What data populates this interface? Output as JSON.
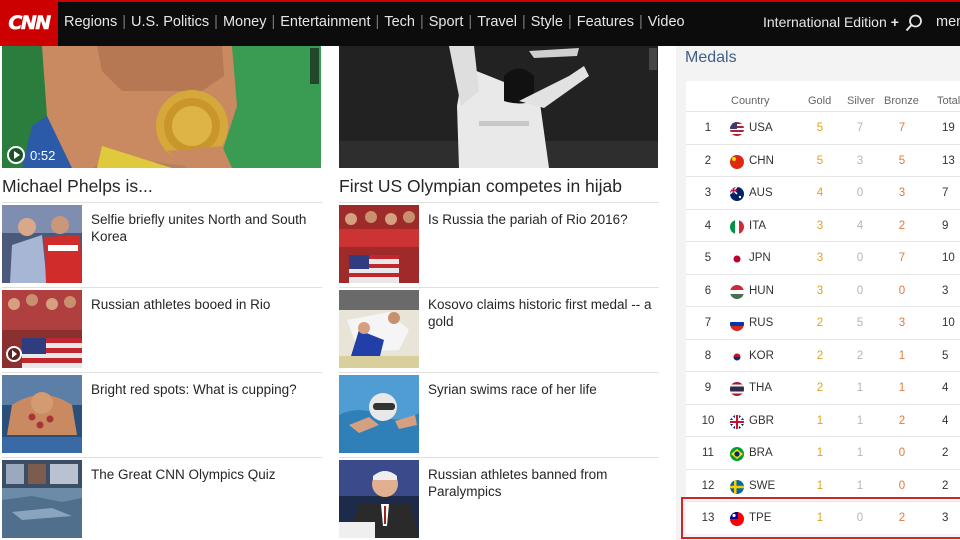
{
  "nav": {
    "logo": "CNN",
    "links": [
      "Regions",
      "U.S. Politics",
      "Money",
      "Entertainment",
      "Tech",
      "Sport",
      "Travel",
      "Style",
      "Features",
      "Video"
    ],
    "edition": "International Edition",
    "edition_plus": "+",
    "menu": "menu"
  },
  "heroes": [
    {
      "headline": "Michael Phelps is...",
      "duration": "0:52"
    },
    {
      "headline": "First US Olympian competes in hijab"
    }
  ],
  "stories_left": [
    {
      "title": "Selfie briefly unites North and South Korea",
      "video": false
    },
    {
      "title": "Russian athletes booed in Rio",
      "video": true
    },
    {
      "title": "Bright red spots: What is cupping?",
      "video": false
    },
    {
      "title": "The Great CNN Olympics Quiz",
      "video": false
    }
  ],
  "stories_right": [
    {
      "title": "Is Russia the pariah of Rio 2016?",
      "video": false
    },
    {
      "title": "Kosovo claims historic first medal -- a gold",
      "video": false
    },
    {
      "title": "Syrian swims race of her life",
      "video": false
    },
    {
      "title": "Russian athletes banned from Paralympics",
      "video": false
    }
  ],
  "medals": {
    "title": "Medals",
    "headers": {
      "country": "Country",
      "gold": "Gold",
      "silver": "Silver",
      "bronze": "Bronze",
      "total": "Total"
    },
    "rows": [
      {
        "rank": "1",
        "code": "USA",
        "gold": "5",
        "silver": "7",
        "bronze": "7",
        "total": "19"
      },
      {
        "rank": "2",
        "code": "CHN",
        "gold": "5",
        "silver": "3",
        "bronze": "5",
        "total": "13"
      },
      {
        "rank": "3",
        "code": "AUS",
        "gold": "4",
        "silver": "0",
        "bronze": "3",
        "total": "7"
      },
      {
        "rank": "4",
        "code": "ITA",
        "gold": "3",
        "silver": "4",
        "bronze": "2",
        "total": "9"
      },
      {
        "rank": "5",
        "code": "JPN",
        "gold": "3",
        "silver": "0",
        "bronze": "7",
        "total": "10"
      },
      {
        "rank": "6",
        "code": "HUN",
        "gold": "3",
        "silver": "0",
        "bronze": "0",
        "total": "3"
      },
      {
        "rank": "7",
        "code": "RUS",
        "gold": "2",
        "silver": "5",
        "bronze": "3",
        "total": "10"
      },
      {
        "rank": "8",
        "code": "KOR",
        "gold": "2",
        "silver": "2",
        "bronze": "1",
        "total": "5"
      },
      {
        "rank": "9",
        "code": "THA",
        "gold": "2",
        "silver": "1",
        "bronze": "1",
        "total": "4"
      },
      {
        "rank": "10",
        "code": "GBR",
        "gold": "1",
        "silver": "1",
        "bronze": "2",
        "total": "4"
      },
      {
        "rank": "11",
        "code": "BRA",
        "gold": "1",
        "silver": "1",
        "bronze": "0",
        "total": "2"
      },
      {
        "rank": "12",
        "code": "SWE",
        "gold": "1",
        "silver": "1",
        "bronze": "0",
        "total": "2"
      },
      {
        "rank": "13",
        "code": "TPE",
        "gold": "1",
        "silver": "0",
        "bronze": "2",
        "total": "3"
      }
    ]
  },
  "colors": {
    "brand": "#cc0000",
    "nav_bg": "#0c0c0c",
    "gold": "#e0a21f",
    "silver": "#b5b5b5",
    "bronze": "#e07a3a",
    "highlight": "#d42424",
    "medals_title": "#405e87"
  }
}
